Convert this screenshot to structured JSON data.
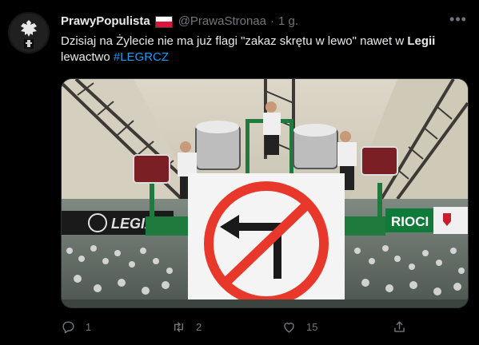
{
  "tweet": {
    "display_name": "PrawyPopulista",
    "handle": "@PrawaStronaa",
    "separator": "·",
    "time": "1 g.",
    "more_label": "•••",
    "text_part1": "Dzisiaj na Żylecie nie ma już flagi \"zakaz skrętu w lewo\" nawet w ",
    "text_bold": "Legii",
    "text_part2": " lewactwo ",
    "hashtag": "#LEGRCZ",
    "media": {
      "banner_left_text": "LEGIA",
      "banner_right_text": "RIOCI"
    }
  },
  "actions": {
    "reply_count": "1",
    "retweet_count": "2",
    "like_count": "15"
  },
  "colors": {
    "background": "#000000",
    "text": "#e7e9ea",
    "secondary": "#71767b",
    "link": "#1d9bf0",
    "flag_red": "#dc143c",
    "sign_red": "#e8382b"
  },
  "icons": [
    "avatar-emblem-icon",
    "poland-flag-icon",
    "more-icon",
    "reply-icon",
    "retweet-icon",
    "like-icon",
    "share-icon"
  ]
}
